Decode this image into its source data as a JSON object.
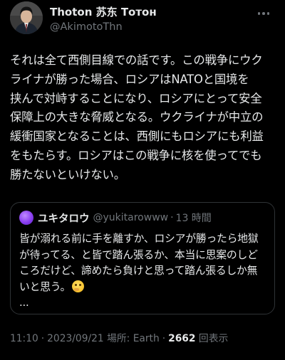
{
  "author": {
    "display_name": "Thoton 苏东 Тотон",
    "handle": "@AkimotoThn"
  },
  "tweet": {
    "lines": [
      "それは全て西側目線での話です。この戦争にウク",
      "ライナが勝った場合、ロシアはNATOと国境を",
      "挟んで対峙することになり、ロシアにとって安全",
      "保障上の大きな脅威となる。ウクライナが中立の",
      "緩衝国家となることは、西側にもロシアにも利益",
      "をもたらす。ロシアはこの戦争に核を使ってでも",
      "勝たないといけない。"
    ]
  },
  "quote": {
    "display_name": "ユキタロウ",
    "handle": "@yukitarowww",
    "separator": "·",
    "time": "13 時間",
    "lines": [
      "皆が溺れる前に手を離すか、ロシアが勝ったら地獄",
      "が待ってる、と皆で踏ん張るか、本当に思案のしど",
      "ころだけど、諦めたら負けと思って踏ん張るしか無",
      "いと思う。",
      "..."
    ],
    "emoji": "thinking-face"
  },
  "meta": {
    "time": "11:10",
    "separator": "·",
    "date": "2023/09/21",
    "location": "場所: Earth",
    "views": "2662",
    "views_label": "回表示"
  },
  "colors": {
    "background": "#000000",
    "text": "#e7e9ea",
    "secondary": "#71767b",
    "border": "#2f3336"
  },
  "icons": {
    "more": "more-horizontal-icon",
    "emoji": "thinking-face-icon"
  }
}
